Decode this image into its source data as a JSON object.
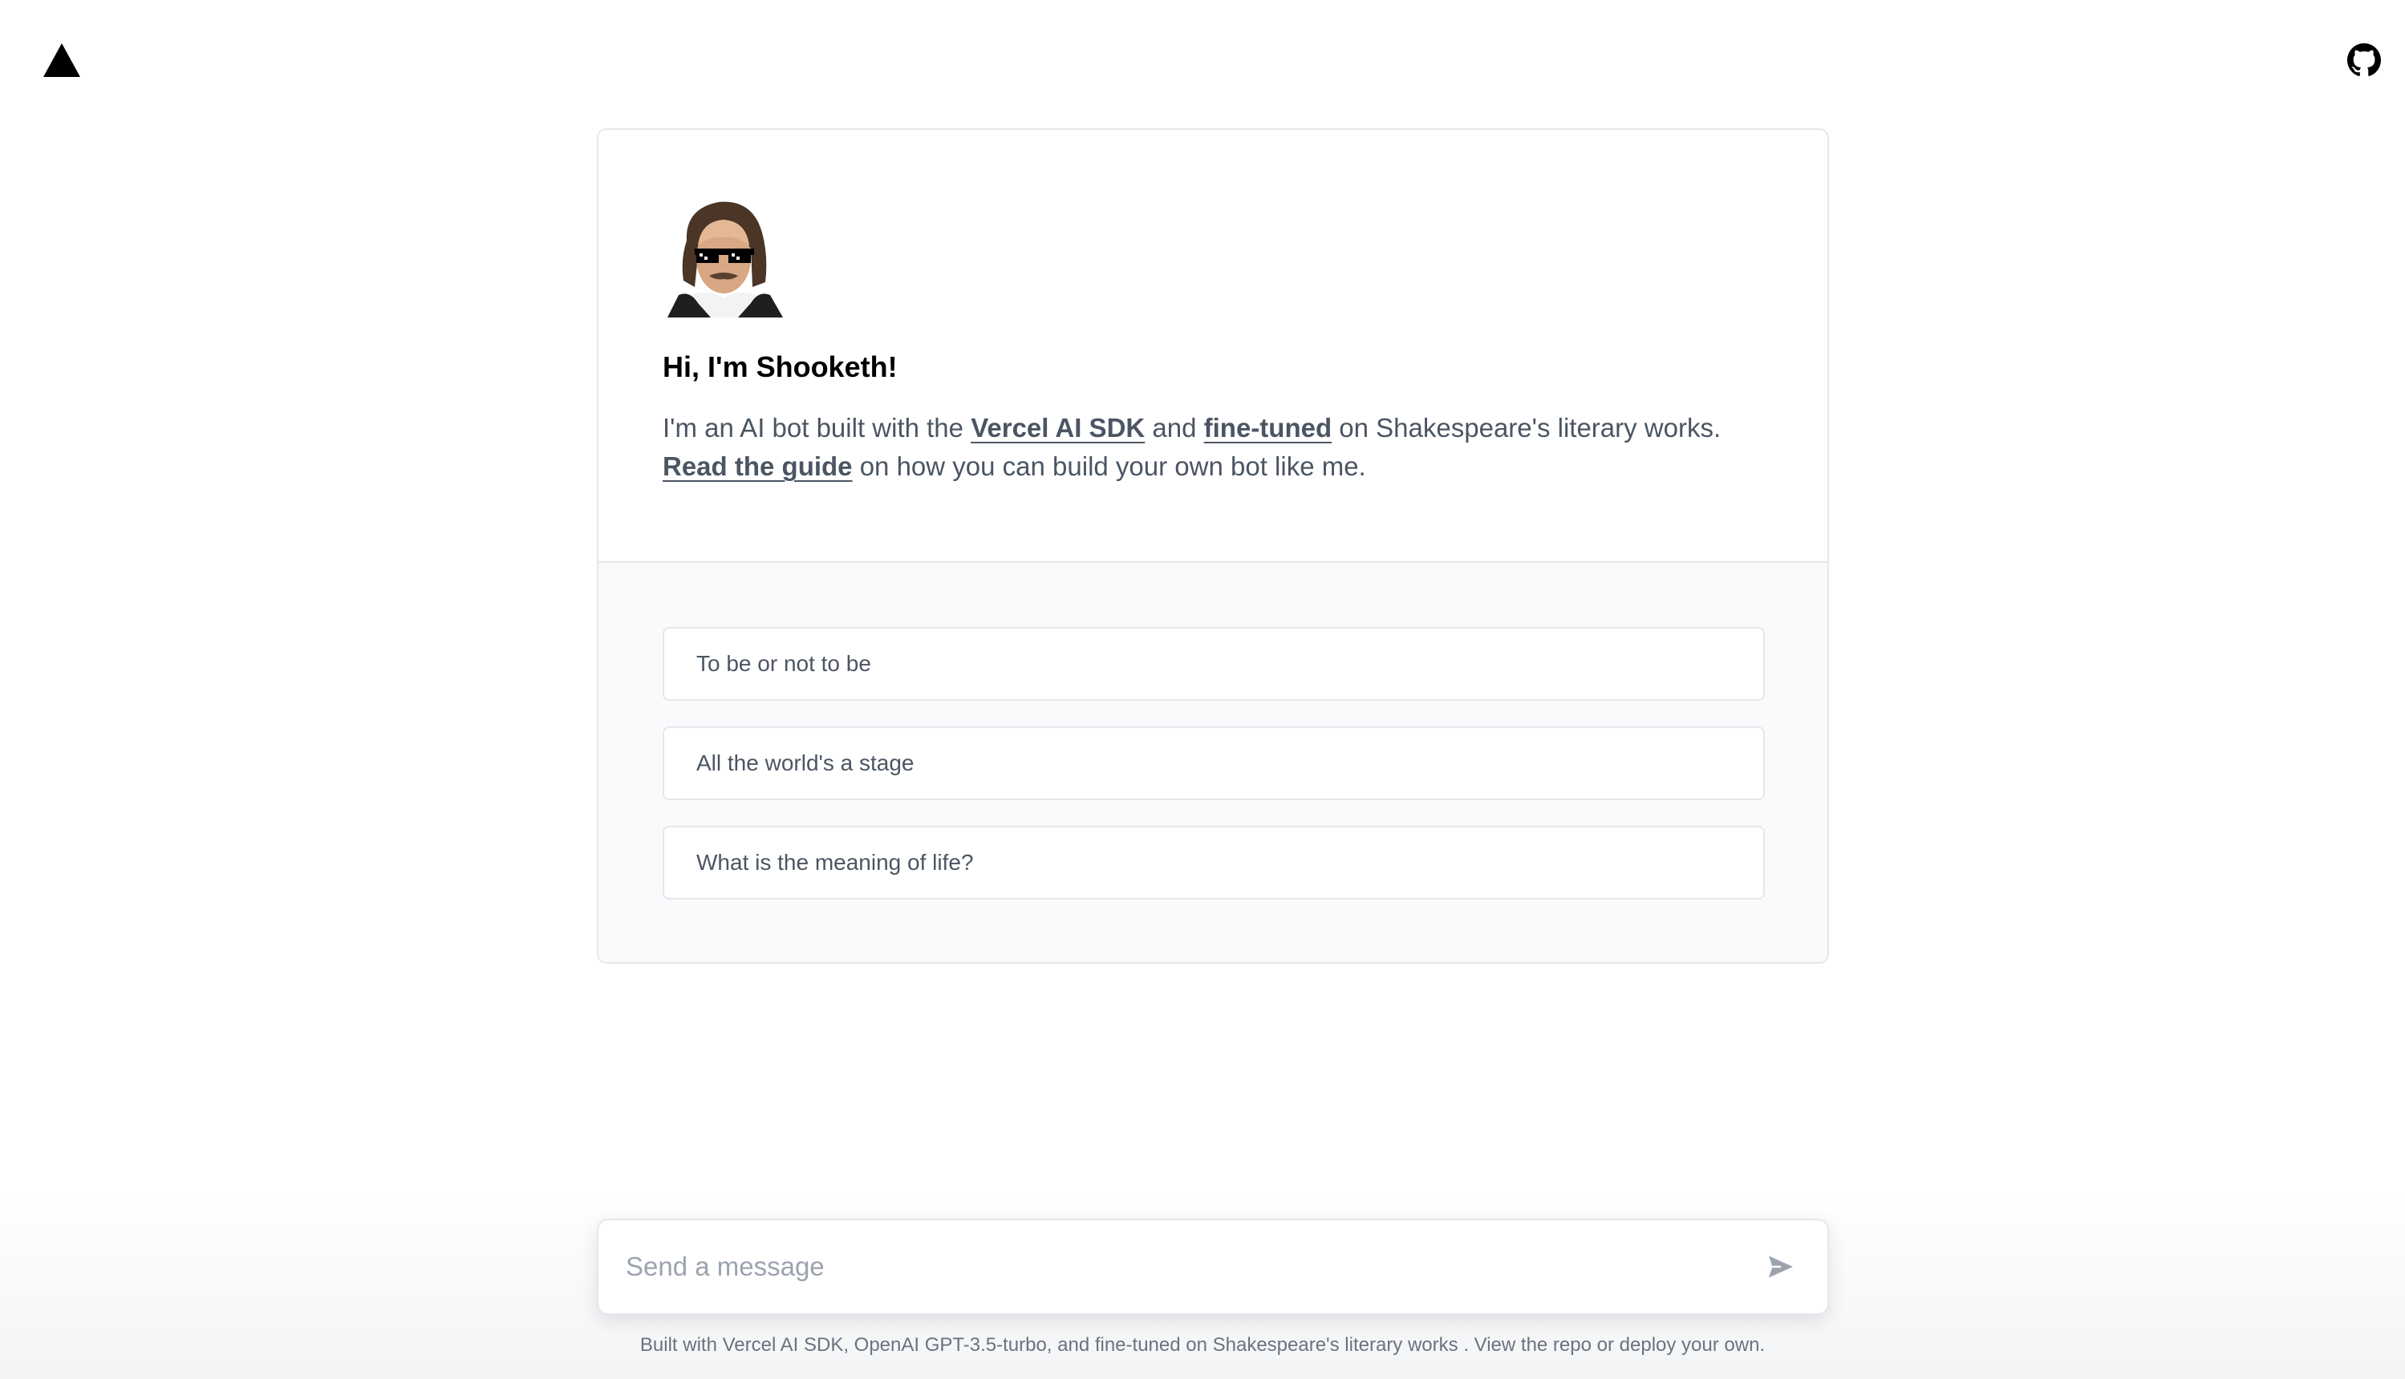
{
  "header": {
    "logo_icon": "vercel-triangle-icon",
    "github_icon": "github-icon"
  },
  "intro": {
    "avatar_icon": "shakespeare-sunglasses-avatar",
    "greeting": "Hi, I'm Shooketh!",
    "desc_part1": "I'm an AI bot built with the ",
    "link_sdk": "Vercel AI SDK",
    "desc_part2": " and ",
    "link_finetuned": "fine-tuned",
    "desc_part3": " on Shakespeare's literary works. ",
    "link_guide": "Read the guide",
    "desc_part4": " on how you can build your own bot like me."
  },
  "examples": [
    {
      "label": "To be or not to be"
    },
    {
      "label": "All the world's a stage"
    },
    {
      "label": "What is the meaning of life?"
    }
  ],
  "composer": {
    "placeholder": "Send a message",
    "value": "",
    "send_icon": "send-arrow-icon"
  },
  "footer": {
    "text": "Built with Vercel AI SDK, OpenAI GPT-3.5-turbo, and fine-tuned on Shakespeare's literary works . View the repo or deploy your own."
  },
  "colors": {
    "text_muted": "#4b5563",
    "border": "#e5e7eb",
    "panel_bg": "#f9fafb",
    "placeholder": "#9ca3af"
  }
}
